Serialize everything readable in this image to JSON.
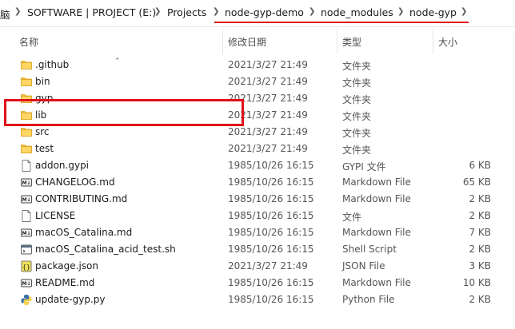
{
  "breadcrumb": {
    "left_clip": "脑",
    "items": [
      "SOFTWARE | PROJECT (E:)",
      "Projects",
      "node-gyp-demo",
      "node_modules",
      "node-gyp"
    ]
  },
  "columns": {
    "name": "名称",
    "modified": "修改日期",
    "type": "类型",
    "size": "大小"
  },
  "highlight_color": "#e0101a",
  "files": [
    {
      "name": ".github",
      "modified": "2021/3/27 21:49",
      "type": "文件夹",
      "size": "",
      "icon": "folder-icon"
    },
    {
      "name": "bin",
      "modified": "2021/3/27 21:49",
      "type": "文件夹",
      "size": "",
      "icon": "folder-icon"
    },
    {
      "name": "gyp",
      "modified": "2021/3/27 21:49",
      "type": "文件夹",
      "size": "",
      "icon": "folder-icon"
    },
    {
      "name": "lib",
      "modified": "2021/3/27 21:49",
      "type": "文件夹",
      "size": "",
      "icon": "folder-icon"
    },
    {
      "name": "src",
      "modified": "2021/3/27 21:49",
      "type": "文件夹",
      "size": "",
      "icon": "folder-icon"
    },
    {
      "name": "test",
      "modified": "2021/3/27 21:49",
      "type": "文件夹",
      "size": "",
      "icon": "folder-icon"
    },
    {
      "name": "addon.gypi",
      "modified": "1985/10/26 16:15",
      "type": "GYPI 文件",
      "size": "6 KB",
      "icon": "file-icon"
    },
    {
      "name": "CHANGELOG.md",
      "modified": "1985/10/26 16:15",
      "type": "Markdown File",
      "size": "65 KB",
      "icon": "markdown-file-icon"
    },
    {
      "name": "CONTRIBUTING.md",
      "modified": "1985/10/26 16:15",
      "type": "Markdown File",
      "size": "2 KB",
      "icon": "markdown-file-icon"
    },
    {
      "name": "LICENSE",
      "modified": "1985/10/26 16:15",
      "type": "文件",
      "size": "2 KB",
      "icon": "file-icon"
    },
    {
      "name": "macOS_Catalina.md",
      "modified": "1985/10/26 16:15",
      "type": "Markdown File",
      "size": "7 KB",
      "icon": "markdown-file-icon"
    },
    {
      "name": "macOS_Catalina_acid_test.sh",
      "modified": "1985/10/26 16:15",
      "type": "Shell Script",
      "size": "2 KB",
      "icon": "shell-script-icon"
    },
    {
      "name": "package.json",
      "modified": "2021/3/27 21:49",
      "type": "JSON File",
      "size": "3 KB",
      "icon": "json-file-icon"
    },
    {
      "name": "README.md",
      "modified": "1985/10/26 16:15",
      "type": "Markdown File",
      "size": "10 KB",
      "icon": "markdown-file-icon"
    },
    {
      "name": "update-gyp.py",
      "modified": "1985/10/26 16:15",
      "type": "Python File",
      "size": "2 KB",
      "icon": "python-file-icon"
    }
  ]
}
